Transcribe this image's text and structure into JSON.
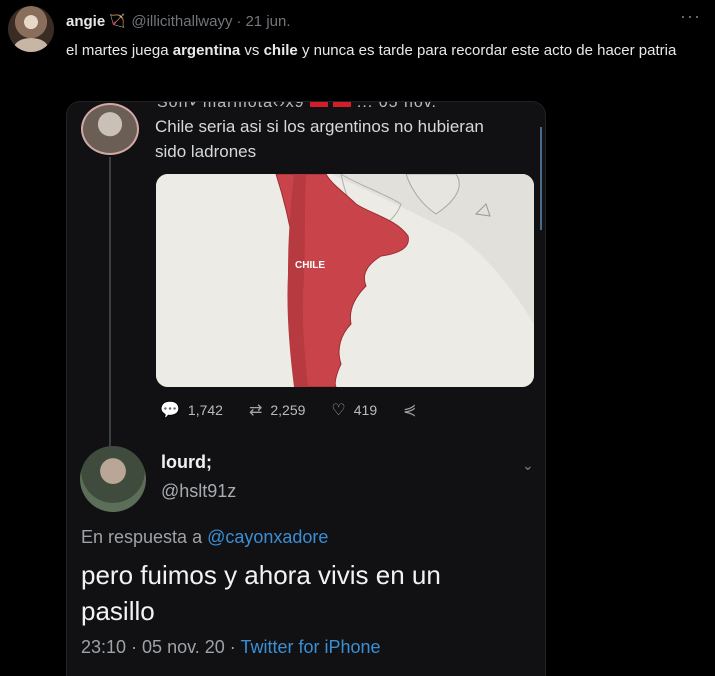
{
  "tweet": {
    "name": "angie",
    "badge_icon": "bow-arrow-icon",
    "handle": "@illicithallwayy",
    "date": "21 jun.",
    "more_icon": "more-dots-icon",
    "text_parts": [
      "el martes juega ",
      "argentina",
      " vs ",
      "chile",
      " y nunca es tarde para recordar este acto de hacer patria"
    ]
  },
  "media": {
    "cut_header": "Son✓marmota‹›x9",
    "cut_date": "05 nov.",
    "quoted_text": "Chile seria asi si los argentinos no hubieran sido ladrones",
    "map_label": "CHILE",
    "actions": {
      "replies": "1,742",
      "retweets": "2,259",
      "likes": "419"
    },
    "reply": {
      "name": "lourd;",
      "handle": "@hslt91z",
      "in_reply_prefix": "En respuesta a",
      "in_reply_mention": "@cayonxadore",
      "text": "pero fuimos y ahora vivis en un pasillo",
      "time": "23:10 · 05 nov. 20 · ",
      "client": "Twitter for iPhone"
    }
  },
  "colors": {
    "accent_link": "#3a8fd4",
    "map_red": "#c9444a",
    "background": "#000000"
  }
}
